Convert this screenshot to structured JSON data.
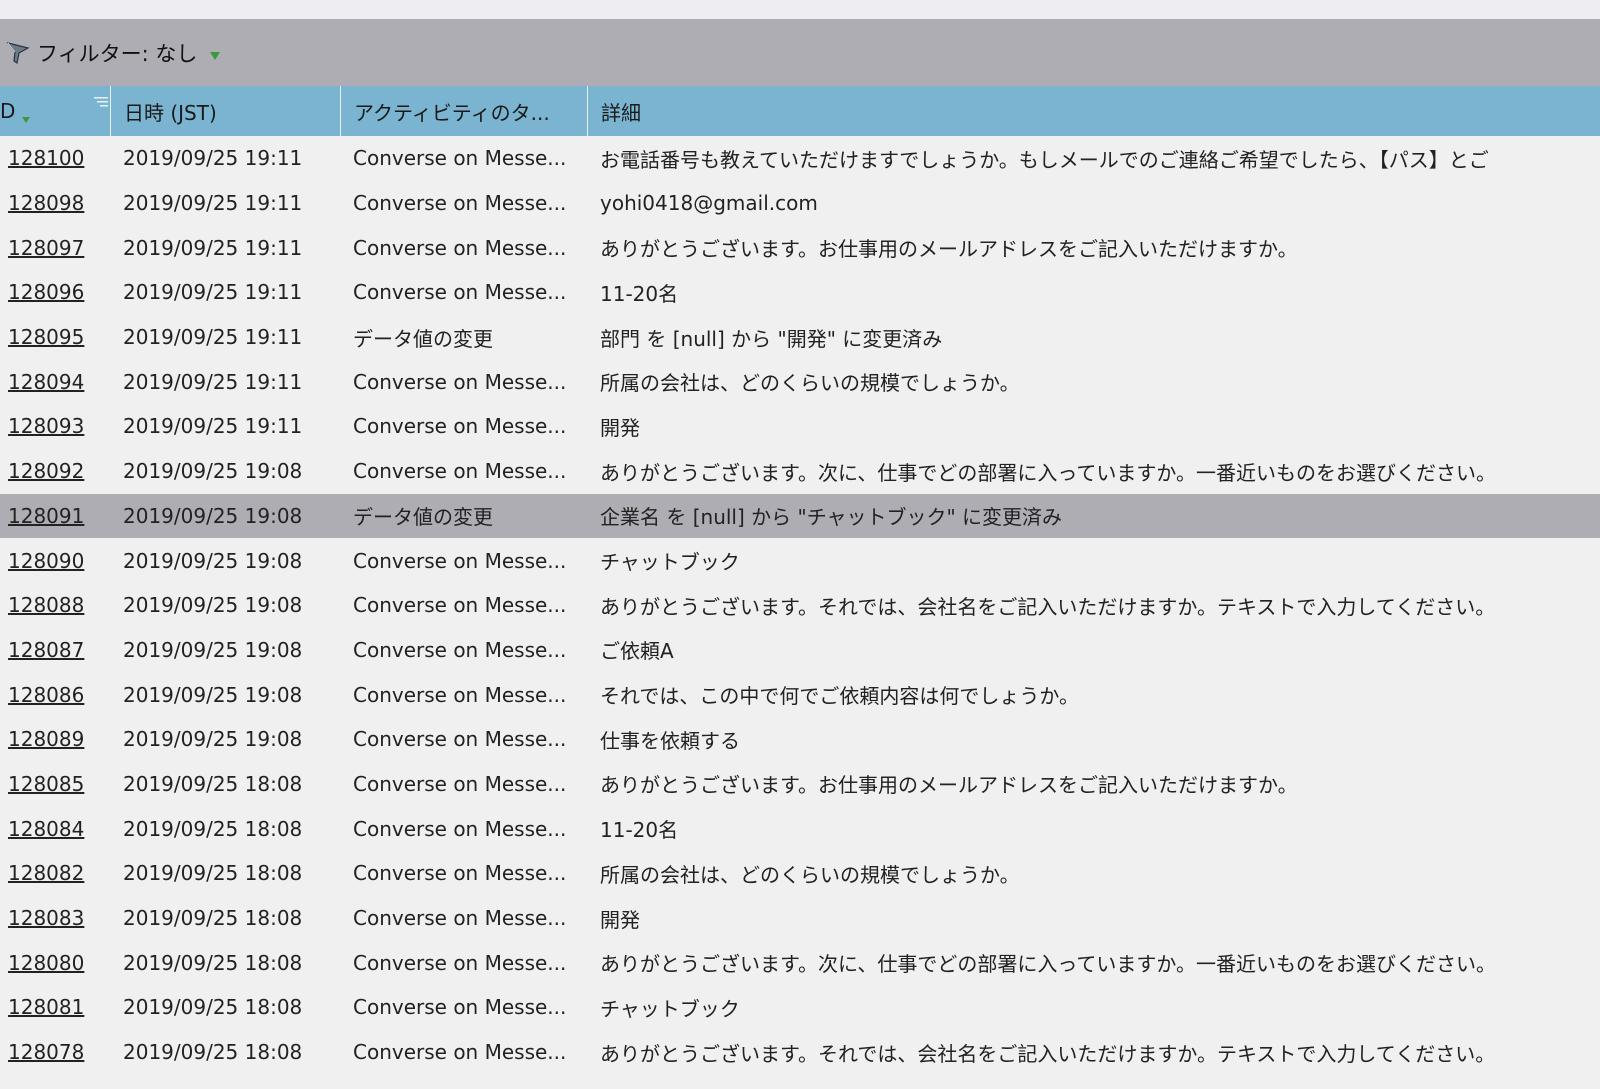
{
  "filter": {
    "label": "フィルター: なし",
    "icon": "funnel-icon",
    "caret_icon": "chevron-down-icon",
    "caret_color": "#3a9a3a"
  },
  "columns": [
    "D",
    "日時 (JST)",
    "アクティビティのタ...",
    "詳細"
  ],
  "colors": {
    "header_bg": "#7ab4d1",
    "filter_bg": "#adadb3",
    "selected_row_bg": "#adadb3",
    "body_bg": "#f0f0f0"
  },
  "rows": [
    {
      "id": "128100",
      "datetime": "2019/09/25 19:11",
      "type": "Converse on Messe...",
      "detail": "お電話番号も教えていただけますでしょうか。もしメールでのご連絡ご希望でしたら、【パス】とご"
    },
    {
      "id": "128098",
      "datetime": "2019/09/25 19:11",
      "type": "Converse on Messe...",
      "detail": "yohi0418@gmail.com"
    },
    {
      "id": "128097",
      "datetime": "2019/09/25 19:11",
      "type": "Converse on Messe...",
      "detail": "ありがとうございます。お仕事用のメールアドレスをご記入いただけますか。"
    },
    {
      "id": "128096",
      "datetime": "2019/09/25 19:11",
      "type": "Converse on Messe...",
      "detail": "11-20名"
    },
    {
      "id": "128095",
      "datetime": "2019/09/25 19:11",
      "type": "データ値の変更",
      "detail": "部門 を [null] から \"開発\" に変更済み"
    },
    {
      "id": "128094",
      "datetime": "2019/09/25 19:11",
      "type": "Converse on Messe...",
      "detail": "所属の会社は、どのくらいの規模でしょうか。"
    },
    {
      "id": "128093",
      "datetime": "2019/09/25 19:11",
      "type": "Converse on Messe...",
      "detail": "開発"
    },
    {
      "id": "128092",
      "datetime": "2019/09/25 19:08",
      "type": "Converse on Messe...",
      "detail": "ありがとうございます。次に、仕事でどの部署に入っていますか。一番近いものをお選びください。"
    },
    {
      "id": "128091",
      "datetime": "2019/09/25 19:08",
      "type": "データ値の変更",
      "detail": "企業名 を [null] から \"チャットブック\" に変更済み",
      "selected": true
    },
    {
      "id": "128090",
      "datetime": "2019/09/25 19:08",
      "type": "Converse on Messe...",
      "detail": "チャットブック"
    },
    {
      "id": "128088",
      "datetime": "2019/09/25 19:08",
      "type": "Converse on Messe...",
      "detail": "ありがとうございます。それでは、会社名をご記入いただけますか。テキストで入力してください。"
    },
    {
      "id": "128087",
      "datetime": "2019/09/25 19:08",
      "type": "Converse on Messe...",
      "detail": "ご依頼A"
    },
    {
      "id": "128086",
      "datetime": "2019/09/25 19:08",
      "type": "Converse on Messe...",
      "detail": "それでは、この中で何でご依頼内容は何でしょうか。"
    },
    {
      "id": "128089",
      "datetime": "2019/09/25 19:08",
      "type": "Converse on Messe...",
      "detail": "仕事を依頼する"
    },
    {
      "id": "128085",
      "datetime": "2019/09/25 18:08",
      "type": "Converse on Messe...",
      "detail": "ありがとうございます。お仕事用のメールアドレスをご記入いただけますか。"
    },
    {
      "id": "128084",
      "datetime": "2019/09/25 18:08",
      "type": "Converse on Messe...",
      "detail": "11-20名"
    },
    {
      "id": "128082",
      "datetime": "2019/09/25 18:08",
      "type": "Converse on Messe...",
      "detail": "所属の会社は、どのくらいの規模でしょうか。"
    },
    {
      "id": "128083",
      "datetime": "2019/09/25 18:08",
      "type": "Converse on Messe...",
      "detail": "開発"
    },
    {
      "id": "128080",
      "datetime": "2019/09/25 18:08",
      "type": "Converse on Messe...",
      "detail": "ありがとうございます。次に、仕事でどの部署に入っていますか。一番近いものをお選びください。"
    },
    {
      "id": "128081",
      "datetime": "2019/09/25 18:08",
      "type": "Converse on Messe...",
      "detail": "チャットブック"
    },
    {
      "id": "128078",
      "datetime": "2019/09/25 18:08",
      "type": "Converse on Messe...",
      "detail": "ありがとうございます。それでは、会社名をご記入いただけますか。テキストで入力してください。"
    }
  ]
}
